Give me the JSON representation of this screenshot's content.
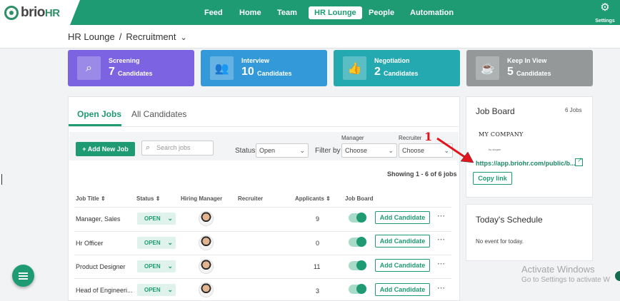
{
  "app": {
    "logo_main": "brio",
    "logo_accent": "HR"
  },
  "nav": {
    "items": [
      "Feed",
      "Home",
      "Team",
      "HR Lounge",
      "People",
      "Automation"
    ],
    "active": "HR Lounge",
    "settings_label": "Settings"
  },
  "breadcrumb": {
    "root": "HR Lounge",
    "separator": "/",
    "current": "Recruitment"
  },
  "stages": [
    {
      "name": "Screening",
      "count": "7",
      "unit": "Candidates",
      "icon": "search-icon",
      "color": "#7b63e2"
    },
    {
      "name": "Interview",
      "count": "10",
      "unit": "Candidates",
      "icon": "users-icon",
      "color": "#3399d9"
    },
    {
      "name": "Negotiation",
      "count": "2",
      "unit": "Candidates",
      "icon": "thumbs-up-icon",
      "color": "#25a9b0"
    },
    {
      "name": "Keep In View",
      "count": "5",
      "unit": "Candidates",
      "icon": "coffee-icon",
      "color": "#959899"
    }
  ],
  "tabs": {
    "open_jobs": "Open Jobs",
    "all_candidates": "All Candidates"
  },
  "toolbar": {
    "add_job": "+ Add New Job",
    "search_placeholder": "Search jobs",
    "status_label": "Status",
    "status_value": "Open",
    "filter_label": "Filter by",
    "manager_label": "Manager",
    "manager_value": "Choose",
    "recruiter_label": "Recruiter",
    "recruiter_value": "Choose"
  },
  "showing": "Showing 1 - 6 of 6 jobs",
  "table": {
    "headers": {
      "job_title": "Job Title",
      "status": "Status",
      "hiring_manager": "Hiring Manager",
      "recruiter": "Recruiter",
      "applicants": "Applicants",
      "job_board": "Job Board"
    },
    "rows": [
      {
        "title": "Manager, Sales",
        "status": "OPEN",
        "applicants": "9",
        "action": "Add Candidate"
      },
      {
        "title": "Hr Officer",
        "status": "OPEN",
        "applicants": "0",
        "action": "Add Candidate"
      },
      {
        "title": "Product Designer",
        "status": "OPEN",
        "applicants": "11",
        "action": "Add Candidate"
      },
      {
        "title": "Head of Engineeri...",
        "status": "OPEN",
        "applicants": "3",
        "action": "Add Candidate"
      }
    ]
  },
  "job_board": {
    "title": "Job Board",
    "count": "6 Jobs",
    "company": "MY COMPANY",
    "company_tagline": "by slogan",
    "url": "https://app.briohr.com/public/b...",
    "copy_link": "Copy link"
  },
  "schedule": {
    "title": "Today's Schedule",
    "empty": "No event for today."
  },
  "annotation": {
    "number": "1",
    "color": "#e0161c"
  },
  "watermark": {
    "line1": "Activate Windows",
    "line2": "Go to Settings to activate W"
  },
  "colors": {
    "brand": "#1e9b72"
  }
}
